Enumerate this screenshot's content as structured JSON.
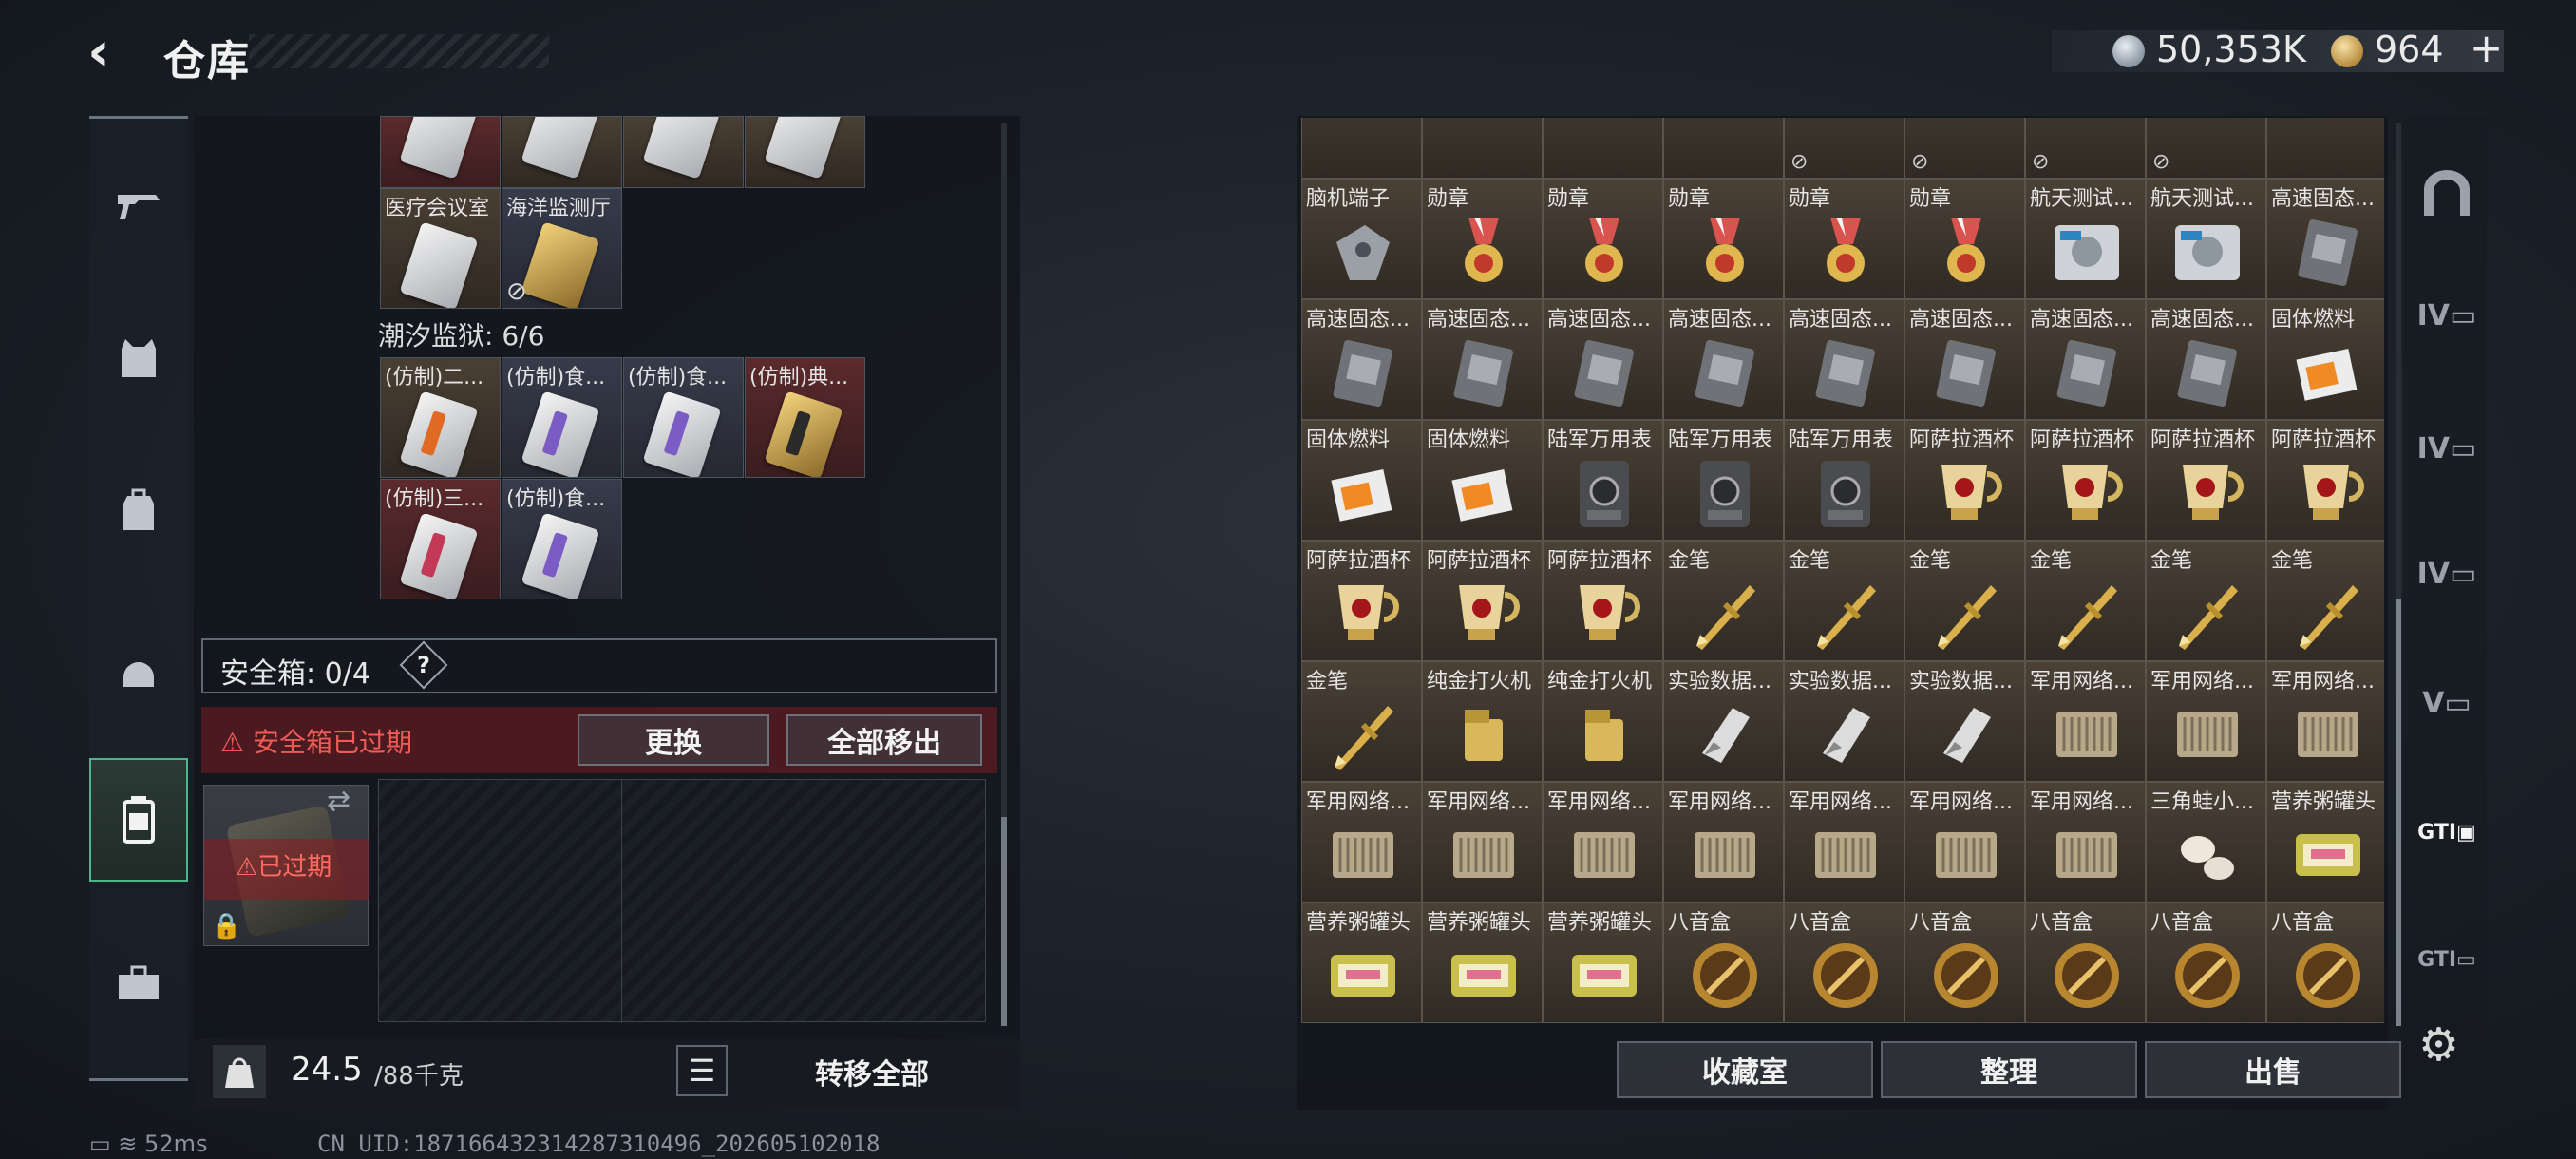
{
  "header": {
    "title": "仓库",
    "currency_silver": "50,353K",
    "currency_gold": "964",
    "plus": "+"
  },
  "left_panel": {
    "top_cards_labels": [
      "",
      "",
      "",
      ""
    ],
    "row_cards": [
      {
        "label": "医疗会议室",
        "color": "brn",
        "doc": "plain"
      },
      {
        "label": "海洋监测厅",
        "color": "blu",
        "doc": "plain",
        "note": "⊘"
      }
    ],
    "section_title": "潮汐监狱: 6/6",
    "cards": [
      {
        "label": "(仿制)二...",
        "color": "brn",
        "stripe": "#e06a24"
      },
      {
        "label": "(仿制)食...",
        "color": "blu",
        "stripe": "#7a5cc4"
      },
      {
        "label": "(仿制)食...",
        "color": "blu",
        "stripe": "#7a5cc4"
      },
      {
        "label": "(仿制)典...",
        "color": "red",
        "stripe": "#2a2a2a",
        "gold": true
      },
      {
        "label": "(仿制)三...",
        "color": "red",
        "stripe": "#c23a58"
      },
      {
        "label": "(仿制)食...",
        "color": "blu",
        "stripe": "#7a5cc4"
      }
    ],
    "safe_label": "安全箱: 0/4",
    "safe_help": "?",
    "expired_text": "⚠ 安全箱已过期",
    "btn_replace": "更换",
    "btn_move_out": "全部移出",
    "case_expired": "⚠已过期",
    "weight": "24.5",
    "weight_max": "/88千克",
    "btn_transfer": "转移全部"
  },
  "right_panel": {
    "top_row_notes": [
      "",
      "",
      "",
      "",
      "⊘",
      "⊘",
      "⊘",
      "⊘",
      ""
    ],
    "items": [
      [
        "脑机端子",
        "勋章",
        "勋章",
        "勋章",
        "勋章",
        "勋章",
        "航天测试...",
        "航天测试...",
        "高速固态..."
      ],
      [
        "高速固态...",
        "高速固态...",
        "高速固态...",
        "高速固态...",
        "高速固态...",
        "高速固态...",
        "高速固态...",
        "高速固态...",
        "固体燃料"
      ],
      [
        "固体燃料",
        "固体燃料",
        "陆军万用表",
        "陆军万用表",
        "陆军万用表",
        "阿萨拉酒杯",
        "阿萨拉酒杯",
        "阿萨拉酒杯",
        "阿萨拉酒杯"
      ],
      [
        "阿萨拉酒杯",
        "阿萨拉酒杯",
        "阿萨拉酒杯",
        "金笔",
        "金笔",
        "金笔",
        "金笔",
        "金笔",
        "金笔"
      ],
      [
        "金笔",
        "纯金打火机",
        "纯金打火机",
        "实验数据...",
        "实验数据...",
        "实验数据...",
        "军用网络...",
        "军用网络...",
        "军用网络..."
      ],
      [
        "军用网络...",
        "军用网络...",
        "军用网络...",
        "军用网络...",
        "军用网络...",
        "军用网络...",
        "军用网络...",
        "三角蛙小...",
        "营养粥罐头"
      ],
      [
        "营养粥罐头",
        "营养粥罐头",
        "营养粥罐头",
        "八音盒",
        "八音盒",
        "八音盒",
        "八音盒",
        "八音盒",
        "八音盒"
      ]
    ],
    "btn_collection": "收藏室",
    "btn_sort": "整理",
    "btn_sell": "出售"
  },
  "right_nav": [
    "IV",
    "IV",
    "IV",
    "V",
    "GTI",
    "GTI"
  ],
  "status": {
    "ping": "52ms",
    "uid": "CN UID:18716643231428731049​6_202605102018"
  }
}
